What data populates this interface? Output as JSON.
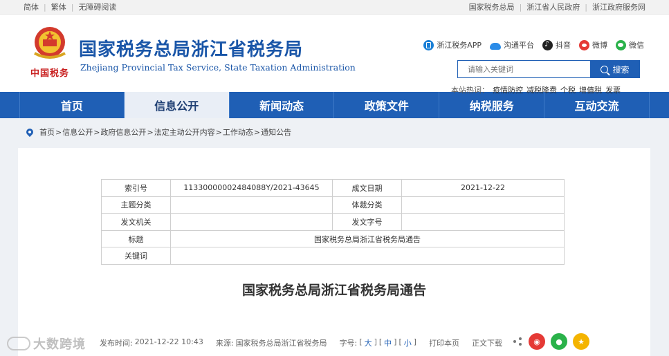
{
  "topbar": {
    "left": [
      "简体",
      "繁体",
      "无障碍阅读"
    ],
    "right": [
      "国家税务总局",
      "浙江省人民政府",
      "浙江政府服务网"
    ]
  },
  "header": {
    "emblem_text": "中国税务",
    "title": "国家税务总局浙江省税务局",
    "subtitle": "Zhejiang Provincial Tax Service, State Taxation Administration",
    "social": [
      {
        "icon": "app-icon",
        "label": "浙江税务APP"
      },
      {
        "icon": "cloud-icon",
        "label": "沟通平台"
      },
      {
        "icon": "tiktok-icon",
        "label": "抖音"
      },
      {
        "icon": "weibo-icon",
        "label": "微博"
      },
      {
        "icon": "wechat-icon",
        "label": "微信"
      }
    ],
    "search_placeholder": "请输入关键词",
    "search_button": "搜索",
    "hot_label": "本站热词：",
    "hot_words": [
      "疫情防控",
      "减税降费",
      "个税",
      "增值税",
      "发票"
    ]
  },
  "nav": [
    "首页",
    "信息公开",
    "新闻动态",
    "政策文件",
    "纳税服务",
    "互动交流"
  ],
  "nav_active": "信息公开",
  "breadcrumb": [
    "首页",
    "信息公开",
    "政府信息公开",
    "法定主动公开内容",
    "工作动态",
    "通知公告"
  ],
  "meta": {
    "index_label": "索引号",
    "index_value": "11330000002484088Y/2021-43645",
    "date_label": "成文日期",
    "date_value": "2021-12-22",
    "topic_label": "主题分类",
    "topic_value": "",
    "genre_label": "体裁分类",
    "genre_value": "",
    "issuer_label": "发文机关",
    "issuer_value": "",
    "docno_label": "发文字号",
    "docno_value": "",
    "title_label": "标题",
    "title_value": "国家税务总局浙江省税务局通告",
    "keywords_label": "关键词",
    "keywords_value": ""
  },
  "doc_title": "国家税务总局浙江省税务局通告",
  "info": {
    "publish_label": "发布时间:",
    "publish_value": "2021-12-22 10:43",
    "source_label": "来源:",
    "source_value": "国家税务总局浙江省税务局",
    "font_label": "字号:",
    "font_large": "大",
    "font_medium": "中",
    "font_small": "小",
    "print": "打印本页",
    "download": "正文下载"
  },
  "watermark": "大数跨境"
}
